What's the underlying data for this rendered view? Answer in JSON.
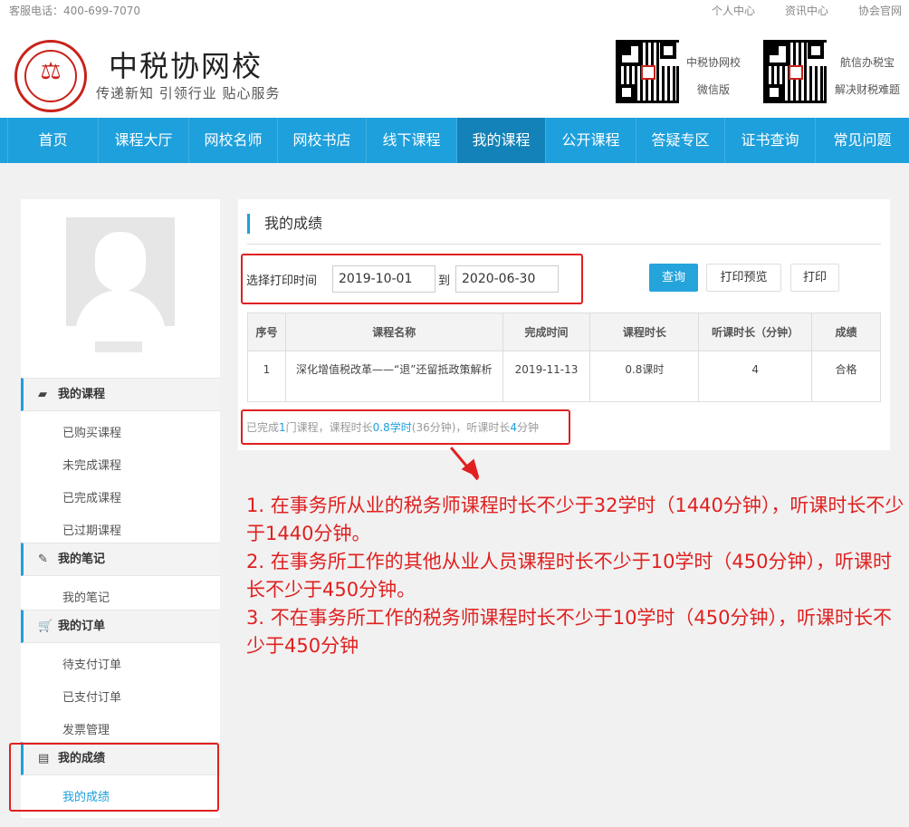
{
  "topbar": {
    "hotline": "客服电话：400-699-7070",
    "links": [
      "个人中心",
      "资讯中心",
      "协会官网"
    ]
  },
  "header": {
    "title": "中税协网校",
    "slogan": "传递新知 引领行业 贴心服务",
    "qr1_label_1": "中税协网校",
    "qr1_label_2": "微信版",
    "qr2_label_1": "航信办税宝",
    "qr2_label_2": "解决财税难题"
  },
  "nav": {
    "items": [
      "首页",
      "课程大厅",
      "网校名师",
      "网校书店",
      "线下课程",
      "我的课程",
      "公开课程",
      "答疑专区",
      "证书查询",
      "常见问题"
    ],
    "active": "我的课程"
  },
  "sidebar": {
    "sections": [
      {
        "title": "我的课程",
        "icon": "book-icon",
        "links": [
          "已购买课程",
          "未完成课程",
          "已完成课程",
          "已过期课程"
        ]
      },
      {
        "title": "我的笔记",
        "icon": "edit-icon",
        "links": [
          "我的笔记"
        ]
      },
      {
        "title": "我的订单",
        "icon": "cart-icon",
        "links": [
          "待支付订单",
          "已支付订单",
          "发票管理"
        ]
      },
      {
        "title": "我的成绩",
        "icon": "document-icon",
        "links": [
          "我的成绩"
        ]
      }
    ],
    "active_link": "我的成绩"
  },
  "main": {
    "title": "我的成绩",
    "select_label": "选择打印时间",
    "start_date": "2019-10-01",
    "to_label": "到",
    "end_date": "2020-06-30",
    "query_button": "查询",
    "preview_button": "打印预览",
    "print_button": "打印",
    "table": {
      "headers": [
        "序号",
        "课程名称",
        "完成时间",
        "课程时长",
        "听课时长（分钟）",
        "成绩"
      ],
      "rows": [
        [
          "1",
          "深化增值税改革——“退”还留抵政策解析",
          "2019-11-13",
          "0.8课时",
          "4",
          "合格"
        ]
      ]
    },
    "summary": {
      "p1": "已完成",
      "count": "1",
      "p2": "门课程，课程时长",
      "hours": "0.8学时",
      "p3": "(36分钟)，听课时长",
      "minutes": "4",
      "p4": "分钟"
    }
  },
  "notes": [
    "1. 在事务所从业的税务师课程时长不少于32学时（1440分钟），听课时长不少于1440分钟。",
    "2. 在事务所工作的其他从业人员课程时长不少于10学时（450分钟），听课时长不少于450分钟。",
    "3. 不在事务所工作的税务师课程时长不少于10学时（450分钟），听课时长不少于450分钟"
  ],
  "colors": {
    "accent": "#1ea0dc",
    "annotation": "#e02020"
  }
}
